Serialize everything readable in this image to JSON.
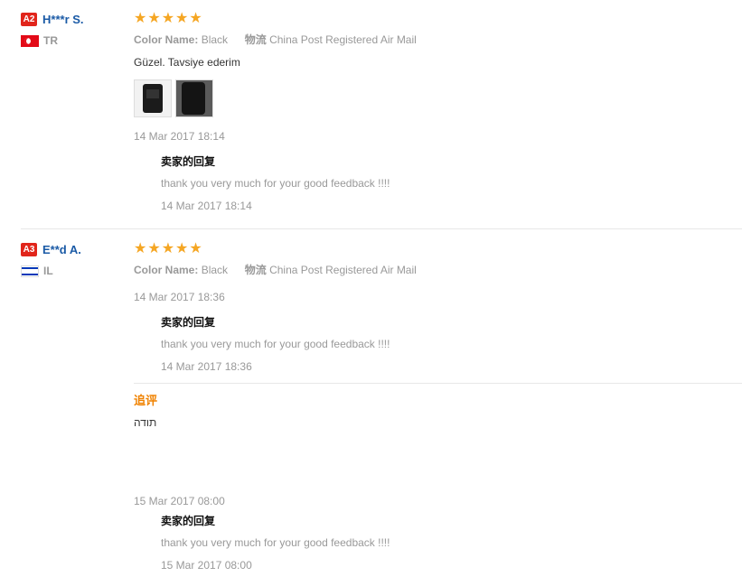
{
  "reviews": [
    {
      "level": "A2",
      "name": "H***r S.",
      "country": "TR",
      "stars": "★★★★★",
      "rating": 5,
      "attr1_key": "Color Name:",
      "attr1_val": "Black",
      "attr2_key": "物流",
      "attr2_val": "China Post Registered Air Mail",
      "text": "Güzel. Tavsiye ederim",
      "date": "14 Mar 2017 18:14",
      "reply": {
        "title": "卖家的回复",
        "text": "thank you very much for your good feedback !!!!",
        "date": "14 Mar 2017 18:14"
      }
    },
    {
      "level": "A3",
      "name": "E**d A.",
      "country": "IL",
      "stars": "★★★★★",
      "rating": 5,
      "attr1_key": "Color Name:",
      "attr1_val": "Black",
      "attr2_key": "物流",
      "attr2_val": "China Post Registered Air Mail",
      "date": "14 Mar 2017 18:36",
      "reply": {
        "title": "卖家的回复",
        "text": "thank you very much for your good feedback !!!!",
        "date": "14 Mar 2017 18:36"
      },
      "followup": {
        "label": "追评",
        "text": "תודה",
        "date": "15 Mar 2017 08:00",
        "reply": {
          "title": "卖家的回复",
          "text": "thank you very much for your good feedback !!!!",
          "date": "15 Mar 2017 08:00"
        }
      }
    }
  ],
  "colors": {
    "badge": "#e1251b",
    "username": "#1a5aa6",
    "stars": "#f5a623",
    "followup_label": "#f08200",
    "muted": "#999999"
  },
  "icons": [
    "turkey-flag-icon",
    "israel-flag-icon",
    "star-icon"
  ]
}
